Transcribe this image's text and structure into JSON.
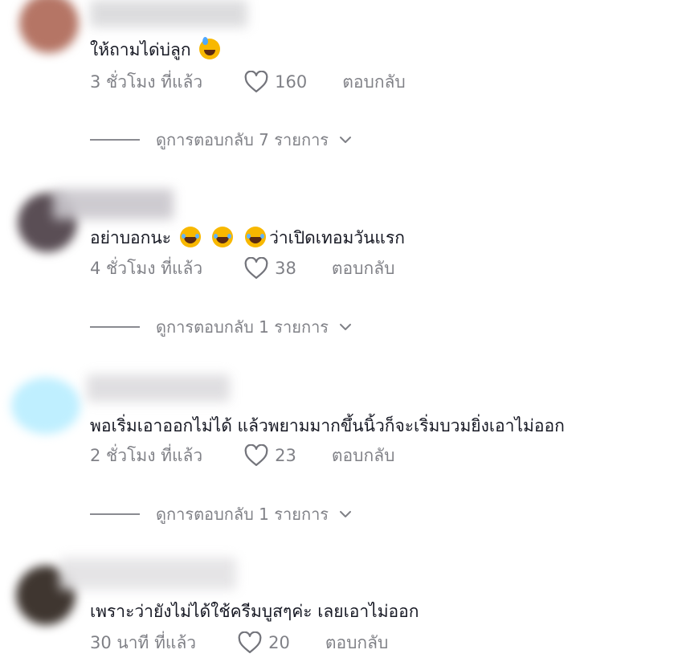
{
  "comments": [
    {
      "text": "ให้ถามได่บ่ลูก",
      "emoji": "sweat-smile-emoji",
      "time": "3 ชั่วโมง ที่แล้ว",
      "likes": "160",
      "reply_label": "ตอบกลับ",
      "view_replies": "ดูการตอบกลับ 7 รายการ"
    },
    {
      "text_prefix": "อย่าบอกนะ",
      "text_suffix": "ว่าเปิดเทอมวันแรก",
      "emoji": "laughing-tears-emoji",
      "time": "4 ชั่วโมง ที่แล้ว",
      "likes": "38",
      "reply_label": "ตอบกลับ",
      "view_replies": "ดูการตอบกลับ 1 รายการ"
    },
    {
      "text": "พอเริ่มเอาออกไม่ได้ แล้วพยามมากขึ้นนิ้วก็จะเริ่มบวมยิ่งเอาไม่ออก",
      "time": "2 ชั่วโมง ที่แล้ว",
      "likes": "23",
      "reply_label": "ตอบกลับ",
      "view_replies": "ดูการตอบกลับ 1 รายการ"
    },
    {
      "text": "เพราะว่ายังไม่ได้ใช้ครีมบูสๆค่ะ เลยเอาไม่ออก",
      "time": "30 นาที ที่แล้ว",
      "likes": "20",
      "reply_label": "ตอบกลับ"
    }
  ],
  "colors": {
    "text": "#161823",
    "muted": "rgba(22,24,35,0.55)",
    "emoji": "#f8b800"
  },
  "icons": {
    "like": "heart-outline-icon",
    "expand": "chevron-down-icon"
  }
}
